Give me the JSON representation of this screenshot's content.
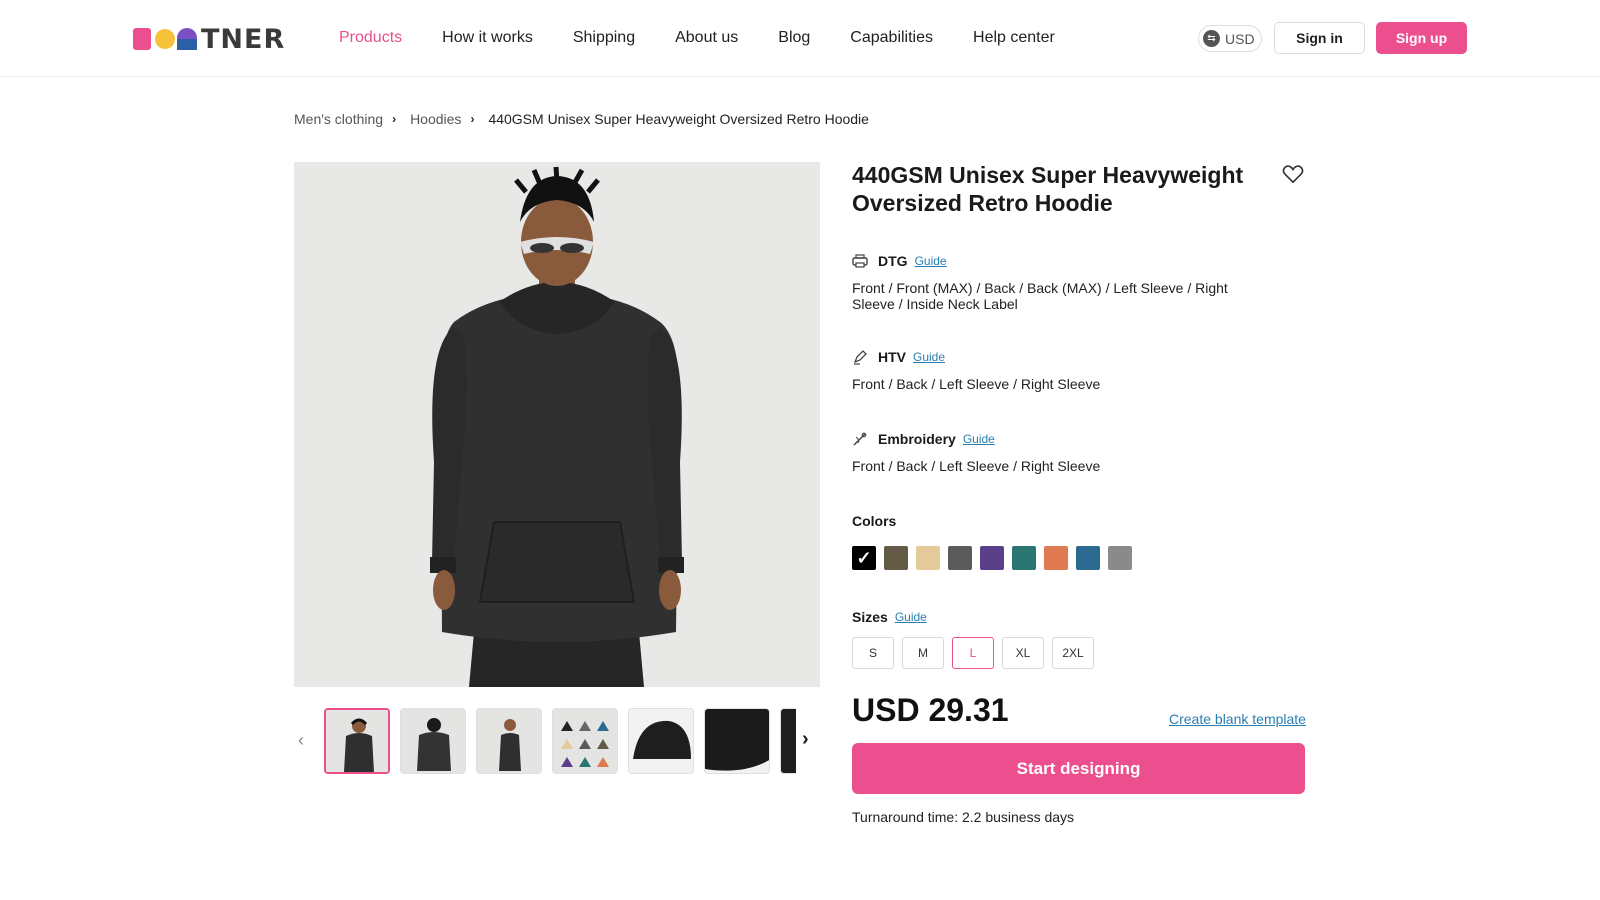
{
  "header": {
    "logo_text": "TNER",
    "nav": [
      "Products",
      "How it works",
      "Shipping",
      "About us",
      "Blog",
      "Capabilities",
      "Help center"
    ],
    "active_nav": "Products",
    "currency": "USD",
    "sign_in": "Sign in",
    "sign_up": "Sign up",
    "brand_colors": {
      "pink": "#ec4f8d",
      "yellow": "#f5c23a",
      "purple": "#7c4fc4",
      "blue": "#2c5fa6"
    }
  },
  "breadcrumb": {
    "items": [
      "Men's clothing",
      "Hoodies"
    ],
    "current": "440GSM Unisex Super Heavyweight Oversized Retro Hoodie"
  },
  "product": {
    "title": "440GSM Unisex Super Heavyweight Oversized Retro Hoodie",
    "methods": [
      {
        "name": "DTG",
        "guide": "Guide",
        "icon": "printer-icon",
        "desc": "Front / Front (MAX) / Back / Back (MAX) / Left Sleeve / Right Sleeve / Inside Neck Label"
      },
      {
        "name": "HTV",
        "guide": "Guide",
        "icon": "pen-icon",
        "desc": "Front / Back / Left Sleeve / Right Sleeve"
      },
      {
        "name": "Embroidery",
        "guide": "Guide",
        "icon": "needle-icon",
        "desc": "Front / Back / Left Sleeve / Right Sleeve"
      }
    ],
    "colors_label": "Colors",
    "colors": [
      "#000000",
      "#635a45",
      "#e5ca99",
      "#5a5a5a",
      "#5a3f8a",
      "#2a7670",
      "#e07850",
      "#2d6a92",
      "#8a8a8a"
    ],
    "selected_color": "#000000",
    "sizes_label": "Sizes",
    "sizes_guide": "Guide",
    "sizes": [
      "S",
      "M",
      "L",
      "XL",
      "2XL"
    ],
    "selected_size": "L",
    "price": "USD 29.31",
    "blank_template": "Create blank template",
    "cta": "Start designing",
    "turnaround": "Turnaround time: 2.2 business days"
  }
}
